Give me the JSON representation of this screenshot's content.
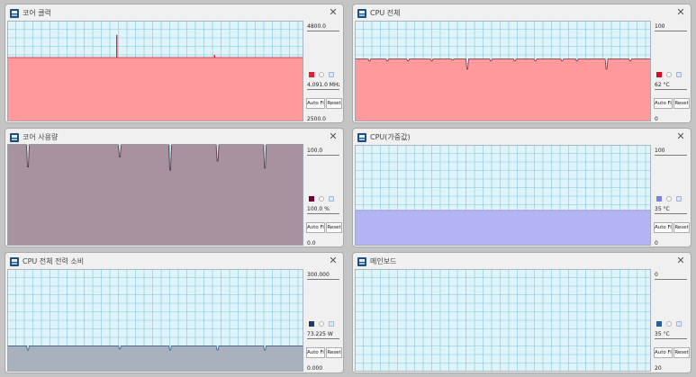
{
  "colors": {
    "plot_bg": "#dff4fa",
    "grid": "#7ec6d9"
  },
  "panels": [
    {
      "title": "코어 클럭",
      "max_label": "4800.0",
      "min_label": "2500.0",
      "current_value": "4,091.0 MHz",
      "auto_fit_label": "Auto Fit",
      "reset_label": "Reset",
      "close_glyph": "✕",
      "series_color": "#e02030",
      "fill": "#ff999c",
      "stroke": "#cc4a50",
      "level": 0.634,
      "spikes": [
        {
          "pos": 0.37,
          "level": 0.86
        },
        {
          "pos": 0.7,
          "level": 0.66
        }
      ]
    },
    {
      "title": "CPU 전체",
      "max_label": "100",
      "min_label": "0",
      "current_value": "62 °C",
      "auto_fit_label": "Auto Fit",
      "reset_label": "Reset",
      "close_glyph": "✕",
      "series_color": "#d01020",
      "fill": "#ff999c",
      "stroke": "#884040",
      "level": 0.62,
      "dips": [
        {
          "pos": 0.05,
          "level": 0.6
        },
        {
          "pos": 0.11,
          "level": 0.6
        },
        {
          "pos": 0.18,
          "level": 0.6
        },
        {
          "pos": 0.26,
          "level": 0.6
        },
        {
          "pos": 0.33,
          "level": 0.61
        },
        {
          "pos": 0.38,
          "level": 0.52
        },
        {
          "pos": 0.46,
          "level": 0.6
        },
        {
          "pos": 0.54,
          "level": 0.6
        },
        {
          "pos": 0.61,
          "level": 0.6
        },
        {
          "pos": 0.7,
          "level": 0.6
        },
        {
          "pos": 0.75,
          "level": 0.6
        },
        {
          "pos": 0.85,
          "level": 0.52
        },
        {
          "pos": 0.93,
          "level": 0.6
        }
      ]
    },
    {
      "title": "코어 사용량",
      "max_label": "100.0",
      "min_label": "0.0",
      "current_value": "100.0 %",
      "auto_fit_label": "Auto Fit",
      "reset_label": "Reset",
      "close_glyph": "✕",
      "series_color": "#700030",
      "fill": "#a9929f",
      "stroke": "#5a3a4a",
      "level": 1.0,
      "dips": [
        {
          "pos": 0.07,
          "level": 0.78
        },
        {
          "pos": 0.38,
          "level": 0.88
        },
        {
          "pos": 0.55,
          "level": 0.75
        },
        {
          "pos": 0.71,
          "level": 0.84
        },
        {
          "pos": 0.87,
          "level": 0.77
        }
      ]
    },
    {
      "title": "CPU(가중값)",
      "max_label": "100",
      "min_label": "0",
      "current_value": "35 °C",
      "auto_fit_label": "Auto Fit",
      "reset_label": "Reset",
      "close_glyph": "✕",
      "series_color": "#8080dd",
      "fill": "#b3b5f2",
      "stroke": "#9093d8",
      "level": 0.35,
      "dips": []
    },
    {
      "title": "CPU 전체 전력 소비",
      "max_label": "300.000",
      "min_label": "0.000",
      "current_value": "73.225 W",
      "auto_fit_label": "Auto Fit",
      "reset_label": "Reset",
      "close_glyph": "✕",
      "series_color": "#233b5c",
      "fill": "#a8b2bf",
      "stroke": "#4c6a8c",
      "level": 0.25,
      "dips": [
        {
          "pos": 0.07,
          "level": 0.21
        },
        {
          "pos": 0.38,
          "level": 0.22
        },
        {
          "pos": 0.55,
          "level": 0.21
        },
        {
          "pos": 0.71,
          "level": 0.21
        },
        {
          "pos": 0.87,
          "level": 0.21
        }
      ]
    },
    {
      "title": "메인보드",
      "max_label": "0",
      "min_label": "20",
      "current_value": "35 °C",
      "auto_fit_label": "Auto Fit",
      "reset_label": "Reset",
      "close_glyph": "✕",
      "series_color": "#1f5fa8",
      "fill": "#dff4fa",
      "stroke": "#dff4fa",
      "level": 0,
      "dips": []
    }
  ]
}
